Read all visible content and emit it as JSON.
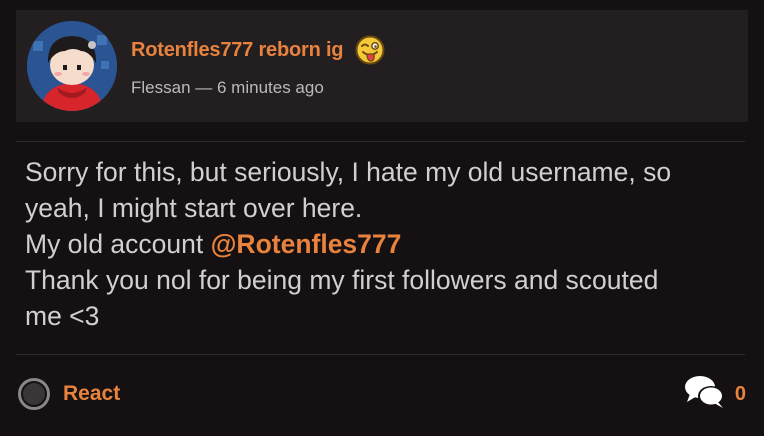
{
  "post": {
    "author_display_name": "Rotenfles777 reborn ig",
    "title_emoji": "tongue-out-emoji",
    "username": "Flessan",
    "separator": "—",
    "timestamp": "6 minutes ago",
    "body_lines": [
      "Sorry for this, but seriously, I hate my old username, so",
      "yeah, I might start over here.",
      "My old account ",
      "Thank you nol for being my first followers and scouted",
      "me <3"
    ],
    "mention": "@Rotenfles777"
  },
  "footer": {
    "react_label": "React",
    "comment_icon": "comments-icon",
    "comment_count": "0"
  },
  "colors": {
    "background": "#151113",
    "header_bg": "#231f21",
    "accent": "#e8823c",
    "text": "#d3cfd1",
    "muted": "#bdb9bb"
  }
}
